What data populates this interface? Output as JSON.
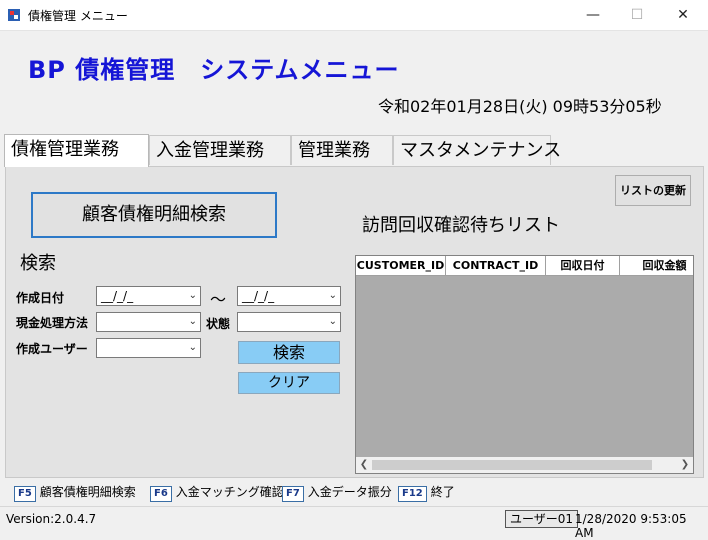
{
  "window": {
    "title": "債権管理 メニュー",
    "minimize": "—",
    "maximize": "☐",
    "close": "✕"
  },
  "header": {
    "app_title": "BP 債権管理　システムメニュー",
    "datetime": "令和02年01月28日(火) 09時53分05秒"
  },
  "tabs": [
    {
      "label": "債権管理業務",
      "active": true
    },
    {
      "label": "入金管理業務",
      "active": false
    },
    {
      "label": "管理業務",
      "active": false
    },
    {
      "label": "マスタメンテナンス",
      "active": false
    }
  ],
  "panel": {
    "customer_search_button": "顧客債権明細検索",
    "refresh_button": "リストの更新",
    "list_title": "訪問回収確認待ちリスト"
  },
  "search": {
    "heading": "検索",
    "created_date_label": "作成日付",
    "date_from": "__/_/_",
    "range_sep": "～",
    "date_to": "__/_/_",
    "cash_method_label": "現金処理方法",
    "cash_method_value": "",
    "status_label": "状態",
    "status_value": "",
    "created_user_label": "作成ユーザー",
    "created_user_value": "",
    "search_button": "検索",
    "clear_button": "クリア"
  },
  "grid": {
    "columns": [
      "CUSTOMER_ID",
      "CONTRACT_ID",
      "回収日付",
      "回収金額"
    ],
    "rows": []
  },
  "function_keys": [
    {
      "key": "F5",
      "label": "顧客債権明細検索"
    },
    {
      "key": "F6",
      "label": "入金マッチング確認"
    },
    {
      "key": "F7",
      "label": "入金データ振分"
    },
    {
      "key": "F12",
      "label": "終了"
    }
  ],
  "status": {
    "version": "Version:2.0.4.7",
    "user": "ユーザー01",
    "timestamp": "1/28/2020 9:53:05 AM"
  },
  "colors": {
    "title_blue": "#1515d6",
    "button_blue": "#88ccf5",
    "focus_border": "#2d79c7",
    "grid_bg": "#ababab"
  }
}
